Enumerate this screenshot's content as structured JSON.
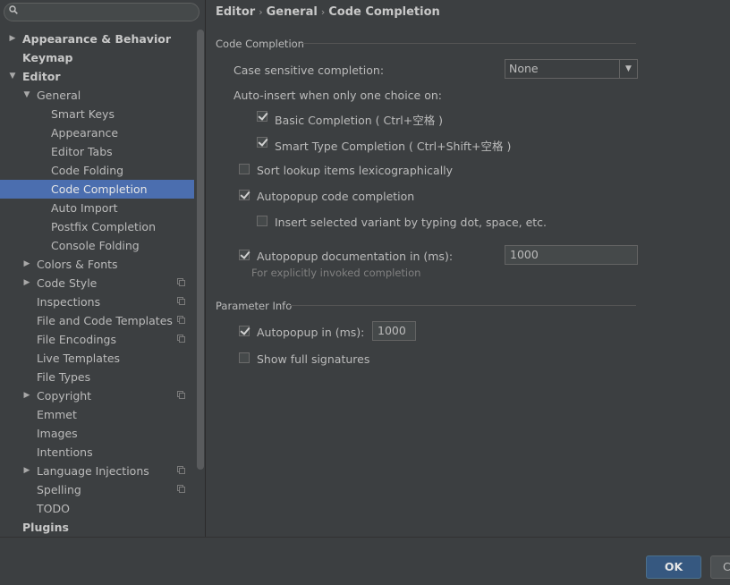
{
  "search": {
    "placeholder": ""
  },
  "breadcrumb": [
    "Editor",
    "General",
    "Code Completion"
  ],
  "tree": [
    {
      "label": "Appearance & Behavior",
      "bold": true,
      "arrow": "right",
      "indent": 0
    },
    {
      "label": "Keymap",
      "bold": true,
      "indent": 0
    },
    {
      "label": "Editor",
      "bold": true,
      "arrow": "down",
      "indent": 0
    },
    {
      "label": "General",
      "arrow": "down",
      "indent": 1
    },
    {
      "label": "Smart Keys",
      "indent": 2
    },
    {
      "label": "Appearance",
      "indent": 2
    },
    {
      "label": "Editor Tabs",
      "indent": 2
    },
    {
      "label": "Code Folding",
      "indent": 2
    },
    {
      "label": "Code Completion",
      "indent": 2,
      "selected": true
    },
    {
      "label": "Auto Import",
      "indent": 2
    },
    {
      "label": "Postfix Completion",
      "indent": 2
    },
    {
      "label": "Console Folding",
      "indent": 2
    },
    {
      "label": "Colors & Fonts",
      "arrow": "right",
      "indent": 1
    },
    {
      "label": "Code Style",
      "arrow": "right",
      "indent": 1,
      "project": true
    },
    {
      "label": "Inspections",
      "indent": 1,
      "project": true
    },
    {
      "label": "File and Code Templates",
      "indent": 1,
      "project": true
    },
    {
      "label": "File Encodings",
      "indent": 1,
      "project": true
    },
    {
      "label": "Live Templates",
      "indent": 1
    },
    {
      "label": "File Types",
      "indent": 1
    },
    {
      "label": "Copyright",
      "arrow": "right",
      "indent": 1,
      "project": true
    },
    {
      "label": "Emmet",
      "indent": 1
    },
    {
      "label": "Images",
      "indent": 1
    },
    {
      "label": "Intentions",
      "indent": 1
    },
    {
      "label": "Language Injections",
      "arrow": "right",
      "indent": 1,
      "project": true
    },
    {
      "label": "Spelling",
      "indent": 1,
      "project": true
    },
    {
      "label": "TODO",
      "indent": 1
    },
    {
      "label": "Plugins",
      "bold": true,
      "indent": 0
    }
  ],
  "code_completion": {
    "section_title": "Code Completion",
    "case_sensitive_label": "Case sensitive completion:",
    "case_sensitive_value": "None",
    "auto_insert_label": "Auto-insert when only one choice on:",
    "basic_completion": {
      "label": "Basic Completion ( Ctrl+空格 )",
      "checked": true
    },
    "smart_type_completion": {
      "label": "Smart Type Completion ( Ctrl+Shift+空格 )",
      "checked": true
    },
    "sort_lookup": {
      "label": "Sort lookup items lexicographically",
      "checked": false
    },
    "autopopup_code": {
      "label": "Autopopup code completion",
      "checked": true
    },
    "insert_selected": {
      "label": "Insert selected variant by typing dot, space, etc.",
      "checked": false
    },
    "autopopup_doc": {
      "label": "Autopopup documentation in (ms):",
      "checked": true,
      "value": "1000"
    },
    "explicit_hint": "For explicitly invoked completion"
  },
  "parameter_info": {
    "section_title": "Parameter Info",
    "autopopup": {
      "label": "Autopopup in (ms):",
      "checked": true,
      "value": "1000"
    },
    "full_signatures": {
      "label": "Show full signatures",
      "checked": false
    }
  },
  "footer": {
    "ok_label": "OK",
    "cancel_label": "Cancel"
  }
}
